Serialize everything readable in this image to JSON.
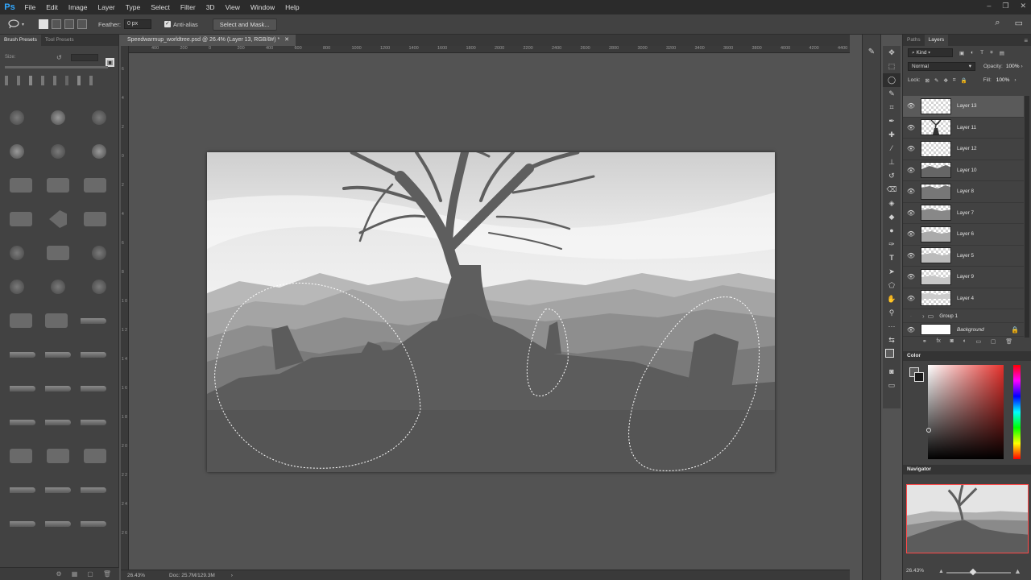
{
  "app": {
    "logo": "Ps"
  },
  "menu": [
    "File",
    "Edit",
    "Image",
    "Layer",
    "Type",
    "Select",
    "Filter",
    "3D",
    "View",
    "Window",
    "Help"
  ],
  "options": {
    "feather_label": "Feather:",
    "feather_value": "0 px",
    "antialias_label": "Anti-alias",
    "select_mask_label": "Select and Mask..."
  },
  "left_panel": {
    "tabs": [
      "Brush Presets",
      "Tool Presets"
    ],
    "size_label": "Size:"
  },
  "document": {
    "tab_title": "Speedwarmup_worldtree.psd @ 26.4% (Layer 13, RGB/8#) *",
    "ruler_h": [
      "400",
      "200",
      "0",
      "200",
      "400",
      "600",
      "800",
      "1000",
      "1200",
      "1400",
      "1600",
      "1800",
      "2000",
      "2200",
      "2400",
      "2600",
      "2800",
      "3000",
      "3200",
      "3400",
      "3600",
      "3800",
      "4000",
      "4200",
      "4400"
    ],
    "ruler_v": [
      "6",
      "4",
      "2",
      "0",
      "2",
      "4",
      "6",
      "8",
      "1 0",
      "1 2",
      "1 4",
      "1 6",
      "1 8",
      "2 0",
      "2 2",
      "2 4",
      "2 6"
    ]
  },
  "status": {
    "zoom": "26.43%",
    "doc": "Doc: 25.7M/129.3M"
  },
  "layers_panel": {
    "tabs": [
      "Paths",
      "Layers"
    ],
    "filter": "Kind",
    "blend_mode": "Normal",
    "opacity_label": "Opacity:",
    "opacity_value": "100%",
    "lock_label": "Lock:",
    "fill_label": "Fill:",
    "fill_value": "100%",
    "layers": [
      {
        "name": "Layer 13",
        "active": true
      },
      {
        "name": "Layer 11",
        "active": false
      },
      {
        "name": "Layer 12",
        "active": false
      },
      {
        "name": "Layer 10",
        "active": false
      },
      {
        "name": "Layer 8",
        "active": false
      },
      {
        "name": "Layer 7",
        "active": false
      },
      {
        "name": "Layer 6",
        "active": false
      },
      {
        "name": "Layer 5",
        "active": false
      },
      {
        "name": "Layer 9",
        "active": false
      },
      {
        "name": "Layer 4",
        "active": false
      }
    ],
    "group": "Group 1",
    "background": "Background"
  },
  "color_panel": {
    "title": "Color"
  },
  "navigator_panel": {
    "title": "Navigator",
    "zoom": "26.43%"
  },
  "colors": {
    "accent_red": "#ff4a4a",
    "ps_blue": "#31a8ff"
  }
}
